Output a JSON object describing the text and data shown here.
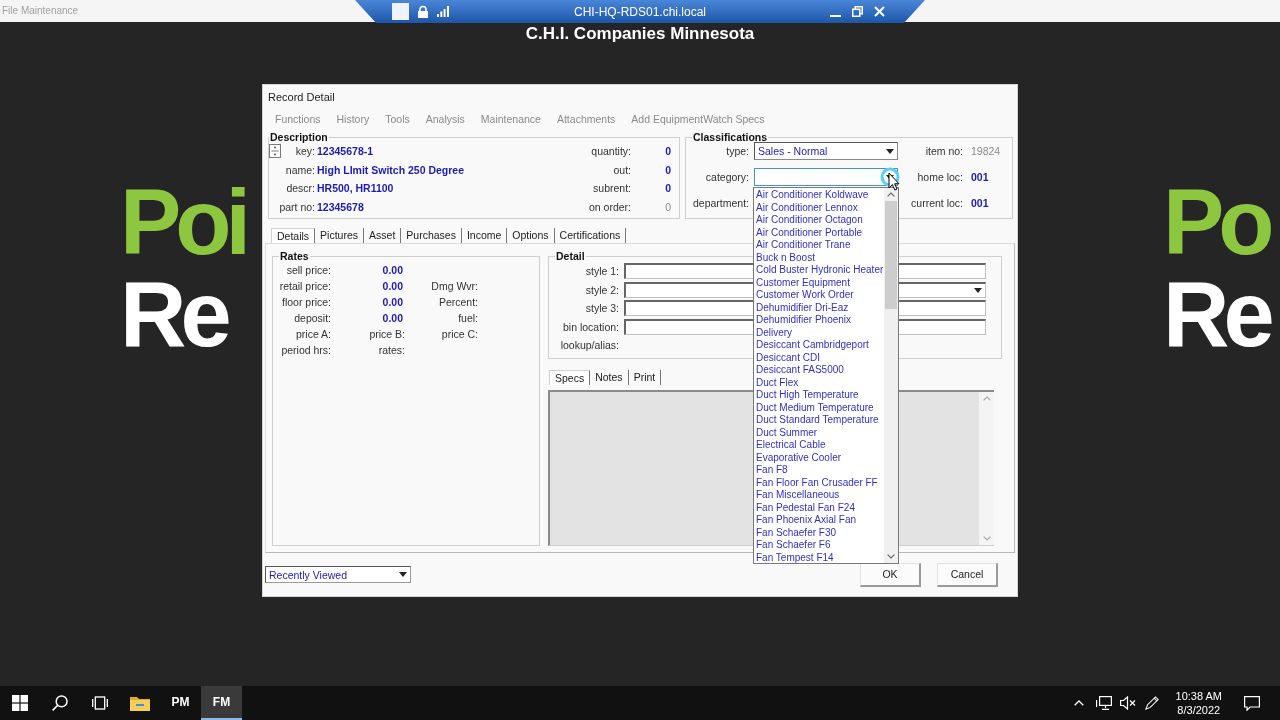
{
  "window": {
    "title": "File Maintenance"
  },
  "remote_bar": {
    "host": "CHI-HQ-RDS01.chi.local"
  },
  "banner": "C.H.I. Companies Minnesota",
  "wallpaper": [
    {
      "top": "Poi",
      "bottom": "Re"
    },
    {
      "top": "Po",
      "bottom": "Re"
    }
  ],
  "dialog": {
    "title": "Record Detail",
    "menu": [
      "Functions",
      "History",
      "Tools",
      "Analysis",
      "Maintenance",
      "Attachments",
      "Add EquipmentWatch Specs"
    ],
    "description": {
      "title": "Description",
      "fields": [
        {
          "label": "key:",
          "value": "12345678-1"
        },
        {
          "label": "name:",
          "value": "High LImit Switch 250 Degree"
        },
        {
          "label": "descr:",
          "value": "HR500, HR1100"
        },
        {
          "label": "part no:",
          "value": "12345678"
        }
      ],
      "counts": [
        {
          "label": "quantity:",
          "value": "0",
          "disabled": false
        },
        {
          "label": "out:",
          "value": "0",
          "disabled": false
        },
        {
          "label": "subrent:",
          "value": "0",
          "disabled": false
        },
        {
          "label": "on order:",
          "value": "0",
          "disabled": true
        }
      ]
    },
    "classifications": {
      "title": "Classifications",
      "rows": [
        {
          "label": "type:",
          "kind": "combo",
          "value": "Sales - Normal",
          "expanded": false
        },
        {
          "label": "category:",
          "kind": "combo",
          "expanded": true,
          "options": [
            {
              "label": "Air Conditioner Koldwave",
              "selected": false
            },
            {
              "label": "Air Conditioner Lennox",
              "selected": false
            },
            {
              "label": "Air Conditioner Octagon",
              "selected": false
            },
            {
              "label": "Air Conditioner Portable",
              "selected": false
            },
            {
              "label": "Air Conditioner Trane",
              "selected": false
            },
            {
              "label": "Buck n Boost",
              "selected": false
            },
            {
              "label": "Cold Buster Hydronic Heater",
              "selected": false
            },
            {
              "label": "Customer Equipment",
              "selected": false
            },
            {
              "label": "Customer Work Order",
              "selected": false
            },
            {
              "label": "Dehumidifier Dri-Eaz",
              "selected": false
            },
            {
              "label": "Dehumidifier Phoenix",
              "selected": false
            },
            {
              "label": "Delivery",
              "selected": false
            },
            {
              "label": "Desiccant Cambridgeport",
              "selected": false
            },
            {
              "label": "Desiccant CDI",
              "selected": false
            },
            {
              "label": "Desiccant FAS5000",
              "selected": false
            },
            {
              "label": "Duct Flex",
              "selected": false
            },
            {
              "label": "Duct High Temperature",
              "selected": false
            },
            {
              "label": "Duct Medium Temperature",
              "selected": false
            },
            {
              "label": "Duct Standard Temperature",
              "selected": false
            },
            {
              "label": "Duct Summer",
              "selected": false
            },
            {
              "label": "Electrical Cable",
              "selected": false
            },
            {
              "label": "Evaporative Cooler",
              "selected": false
            },
            {
              "label": "Fan F8",
              "selected": false
            },
            {
              "label": "Fan Floor Fan Crusader FF",
              "selected": false
            },
            {
              "label": "Fan Miscellaneous",
              "selected": false
            },
            {
              "label": "Fan Pedestal Fan F24",
              "selected": false
            },
            {
              "label": "Fan Phoenix Axial Fan",
              "selected": false
            },
            {
              "label": "Fan Schaefer F30",
              "selected": false
            },
            {
              "label": "Fan Schaefer F6",
              "selected": false
            },
            {
              "label": "Fan Tempest F14",
              "selected": false
            }
          ]
        },
        {
          "label": "department:",
          "kind": "covered"
        }
      ],
      "info": [
        {
          "label": "item no:",
          "value": "19824",
          "disabled": true
        },
        {
          "label": "home loc:",
          "value": "001",
          "disabled": false
        },
        {
          "label": "current loc:",
          "value": "001",
          "disabled": false
        }
      ]
    },
    "tabs": [
      {
        "label": "Details",
        "selected": true
      },
      {
        "label": "Pictures",
        "selected": false
      },
      {
        "label": "Asset",
        "selected": false
      },
      {
        "label": "Purchases",
        "selected": false
      },
      {
        "label": "Income",
        "selected": false
      },
      {
        "label": "Options",
        "selected": false
      },
      {
        "label": "Certifications",
        "selected": false
      }
    ],
    "rates": {
      "title": "Rates",
      "rows": [
        [
          {
            "kind": "label",
            "text": "sell price:"
          },
          {
            "kind": "value",
            "text": "0.00"
          }
        ],
        [
          {
            "kind": "label",
            "text": "retail price:"
          },
          {
            "kind": "value",
            "text": "0.00"
          },
          {
            "kind": "label",
            "text": "Dmg Wvr:"
          }
        ],
        [
          {
            "kind": "label",
            "text": "floor price:"
          },
          {
            "kind": "value",
            "text": "0.00"
          },
          {
            "kind": "label",
            "text": "Percent:"
          }
        ],
        [
          {
            "kind": "label",
            "text": "deposit:"
          },
          {
            "kind": "value",
            "text": "0.00"
          },
          {
            "kind": "label",
            "text": "fuel:"
          }
        ],
        [
          {
            "kind": "label",
            "text": "price A:"
          },
          {
            "kind": "label",
            "text": "price B:"
          },
          {
            "kind": "label",
            "text": "price C:"
          }
        ],
        [
          {
            "kind": "label",
            "text": "period hrs:"
          },
          {
            "kind": "label",
            "text": "rates:"
          }
        ]
      ]
    },
    "detail": {
      "title": "Detail",
      "fields": [
        {
          "label": "style 1:",
          "kind": "input"
        },
        {
          "label": "style 2:",
          "kind": "combo"
        },
        {
          "label": "style 3:",
          "kind": "input"
        },
        {
          "label": "bin location:",
          "kind": "input"
        },
        {
          "label": "lookup/alias:",
          "kind": "text"
        }
      ]
    },
    "subtabs": [
      {
        "label": "Specs",
        "selected": true
      },
      {
        "label": "Notes",
        "selected": false
      },
      {
        "label": "Print",
        "selected": false
      }
    ],
    "footer": {
      "recent": "Recently Viewed",
      "buttons": [
        "OK",
        "Cancel"
      ]
    }
  },
  "taskbar": {
    "apps": [
      {
        "label": "PM",
        "selected": false
      },
      {
        "label": "FM",
        "selected": true
      }
    ],
    "time": "10:38 AM",
    "date": "8/3/2022"
  }
}
